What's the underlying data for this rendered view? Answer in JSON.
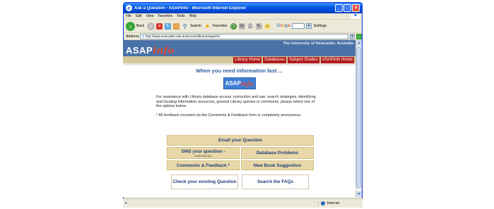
{
  "window": {
    "title": "Ask a Question - ASAPinfo - Microsoft Internet Explorer",
    "flag_glyph": "⚑"
  },
  "menu": [
    "File",
    "Edit",
    "View",
    "Favorites",
    "Tools",
    "Help"
  ],
  "toolbar": {
    "back_label": "Back",
    "search_label": "Search",
    "favorites_label": "Favorites",
    "google_label": "Google",
    "settings_label": "Settings"
  },
  "address": {
    "label": "Address",
    "url": "http://www.newcastle.edu.au/service/library/asapinfo/",
    "go_glyph": "→"
  },
  "site": {
    "university": "The University of Newcastle, Australia",
    "logo_main": "ASAP",
    "logo_accent": "info",
    "nav": [
      "Library Home",
      "Databases",
      "Subject Guides",
      "ASAPinfo Home"
    ],
    "heading": "When you need information fast ...",
    "badge_main": "ASAP",
    "badge_accent": "info",
    "intro": "For assistance with Library database access, instruction and use, search strategies, identifying and locating information resources, general Library queries or comments, please select one of the options below.",
    "note": "* All feedback received via the Comments & Feedback form is completely anonymous."
  },
  "options": {
    "email": "Email your Question",
    "sms": "SMS your question -",
    "sms_number": "0429 039 342",
    "database": "Database Problems",
    "comments": "Comments & Feedback *",
    "book": "New Book Suggestion",
    "check": "Check your existing Question",
    "faqs": "Search the FAQs"
  },
  "status": {
    "zone": "Internet"
  },
  "colors": {
    "header_blue": "#4a72a6",
    "nav_red": "#b31b1b",
    "option_tan": "#e8d8a8",
    "heading_blue": "#2e5aa0"
  }
}
